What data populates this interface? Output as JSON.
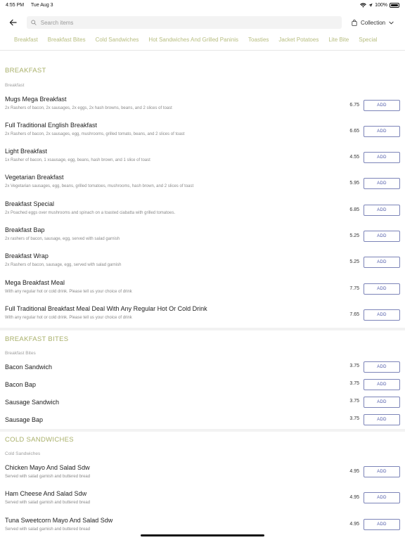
{
  "status": {
    "time": "4:55 PM",
    "date": "Tue Aug 3",
    "battery": "100%"
  },
  "search": {
    "placeholder": "Search items"
  },
  "collection_label": "Collection",
  "tabs": [
    {
      "label": "Breakfast",
      "active": true
    },
    {
      "label": "Breakfast Bites",
      "active": false
    },
    {
      "label": "Cold Sandwiches",
      "active": false
    },
    {
      "label": "Hot Sandwiches And Grilled Paninis",
      "active": false
    },
    {
      "label": "Toasties",
      "active": false
    },
    {
      "label": "Jacket Potatoes",
      "active": false
    },
    {
      "label": "Lite Bite",
      "active": false
    },
    {
      "label": "Special",
      "active": false
    }
  ],
  "add_label": "ADD",
  "sections": [
    {
      "title": "BREAKFAST",
      "subtitle": "Breakfast",
      "items": [
        {
          "name": "Mugs Mega Breakfast",
          "desc": "2x Rashers of bacon, 2x sausages, 2x eggs, 2x hash browns, beans, and 2 slices of toast",
          "price": "6.75"
        },
        {
          "name": "Full Traditional English Breakfast",
          "desc": "2x Rashers of bacon, 2x sausages, egg, mushrooms, grilled tomato, beans, and 2 slices of toast",
          "price": "6.65"
        },
        {
          "name": "Light Breakfast",
          "desc": "1x Rasher of bacon, 1 xsausage, egg, beans, hash brown, and 1 slice of toast",
          "price": "4.55"
        },
        {
          "name": "Vegetarian Breakfast",
          "desc": "2x Vegetarian sausages, egg, beans, grilled tomatoes, mushrooms, hash brown, and 2 slices of toast",
          "price": "5.95"
        },
        {
          "name": "Breakfast Special",
          "desc": "2x Poached eggs over mushrooms and spinach on a toasted ciabatta with grilled tomatoes.",
          "price": "6.85"
        },
        {
          "name": "Breakfast Bap",
          "desc": "2x rashers of bacon, sausage, egg, served with salad garnish",
          "price": "5.25"
        },
        {
          "name": "Breakfast Wrap",
          "desc": "2x Rashers of bacon, sausage, egg, served with salad garnish",
          "price": "5.25"
        },
        {
          "name": "Mega Breakfast Meal",
          "desc": "With any regular hot or cold drink. Please tell us your choice of drink",
          "price": "7.75"
        },
        {
          "name": "Full Traditional Breakfast Meal Deal With Any Regular Hot Or Cold Drink",
          "desc": "With any regular hot or cold drink. Please tell us your choice of drink",
          "price": "7.65"
        }
      ]
    },
    {
      "title": "BREAKFAST BITES",
      "subtitle": "Breakfast Bites",
      "items": [
        {
          "name": "Bacon Sandwich",
          "desc": "",
          "price": "3.75"
        },
        {
          "name": "Bacon Bap",
          "desc": "",
          "price": "3.75"
        },
        {
          "name": "Sausage Sandwich",
          "desc": "",
          "price": "3.75"
        },
        {
          "name": "Sausage Bap",
          "desc": "",
          "price": "3.75"
        }
      ]
    },
    {
      "title": "COLD SANDWICHES",
      "subtitle": "Cold Sandwiches",
      "items": [
        {
          "name": "Chicken Mayo And Salad Sdw",
          "desc": "Served with salad garnish and buttered bread",
          "price": "4.95"
        },
        {
          "name": "Ham Cheese And Salad Sdw",
          "desc": "Served with salad garnish and buttered bread",
          "price": "4.95"
        },
        {
          "name": "Tuna Sweetcorn Mayo And Salad Sdw",
          "desc": "Served with salad garnish and buttered bread",
          "price": "4.95"
        }
      ]
    }
  ]
}
